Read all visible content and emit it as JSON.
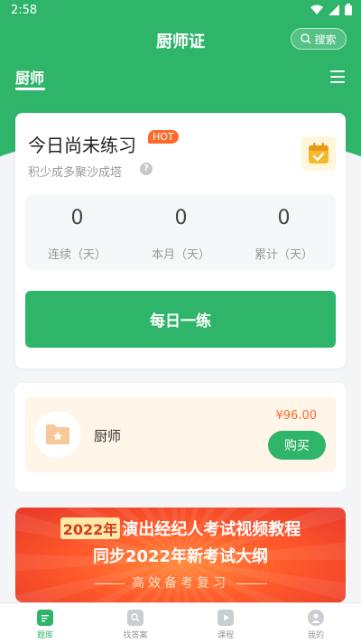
{
  "status_bar": {
    "time": "2:58"
  },
  "header": {
    "title": "厨师证",
    "search_label": "搜索",
    "subject_tab": "厨师"
  },
  "practice": {
    "title": "今日尚未练习",
    "hot_badge": "HOT",
    "subtitle": "积少成多聚沙成塔",
    "stats": [
      {
        "value": "0",
        "label": "连续（天）"
      },
      {
        "value": "0",
        "label": "本月（天）"
      },
      {
        "value": "0",
        "label": "累计（天）"
      }
    ],
    "daily_button": "每日一练"
  },
  "course": {
    "name": "厨师",
    "price": "¥96.00",
    "buy_label": "购买"
  },
  "banner": {
    "year": "2022年",
    "line1": "演出经纪人考试视频教程",
    "line2": "同步2022年新考试大纲",
    "line3": "高效备考复习"
  },
  "tabbar": [
    {
      "label": "题库",
      "icon": "question-bank-icon",
      "active": true
    },
    {
      "label": "找答案",
      "icon": "find-answer-icon",
      "active": false
    },
    {
      "label": "课程",
      "icon": "course-play-icon",
      "active": false
    },
    {
      "label": "我的",
      "icon": "profile-icon",
      "active": false
    }
  ],
  "colors": {
    "brand_green": "#2fb56a",
    "hot_orange": "#ff6a2b",
    "price_orange": "#ff6a2b"
  }
}
